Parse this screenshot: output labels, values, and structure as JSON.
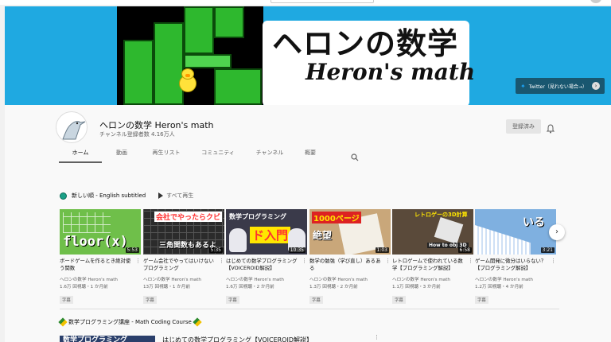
{
  "banner": {
    "title": "ヘロンの数学",
    "subtitle": "Heron's math",
    "twitter_link": "Twitter（見れない場合→）"
  },
  "channel": {
    "name": "ヘロンの数学 Heron's math",
    "subscribers": "チャンネル登録者数 4.16万人",
    "subscribe_button": "登録済み"
  },
  "tabs": [
    "ホーム",
    "動画",
    "再生リスト",
    "コミュニティ",
    "チャンネル",
    "概要"
  ],
  "shelf1": {
    "title": "新しい順 - English subtitled",
    "play_all": "すべて再生"
  },
  "videos": [
    {
      "title": "ボードゲームを作るとき絶対使う関数",
      "channel": "ヘロンの数学 Heron's math",
      "meta": "1.6万 回視聴・1 か月前",
      "badge": "字幕",
      "duration": "5:53",
      "thumb_text": "floor(x)",
      "thumb_bg": "#6fbf4a"
    },
    {
      "title": "ゲーム会社でやってはいけないプログラミング",
      "channel": "ヘロンの数学 Heron's math",
      "meta": "13万 回視聴・1 か月前",
      "badge": "字幕",
      "duration": "5:35",
      "thumb_text": "会社でやったらクビ",
      "thumb_text2": "三角関数もあるよ",
      "thumb_bg": "#2b2b2b"
    },
    {
      "title": "はじめての数学プログラミング【VOICEROID解説】",
      "channel": "ヘロンの数学 Heron's math",
      "meta": "1.6万 回視聴・2 か月前",
      "badge": "字幕",
      "duration": "10:35",
      "thumb_text": "数学プログラミング",
      "thumb_text2": "ド入門",
      "thumb_bg": "#3a3a4a"
    },
    {
      "title": "数学の勉強（学び直し）あるある",
      "channel": "ヘロンの数学 Heron's math",
      "meta": "1.3万 回視聴・2 か月前",
      "badge": "字幕",
      "duration": "1:03",
      "thumb_text": "1000ページ",
      "thumb_text2": "絶望",
      "thumb_bg": "#c9a77a"
    },
    {
      "title": "レトロゲームで使われている数学【プログラミング解説】",
      "channel": "ヘロンの数学 Heron's math",
      "meta": "1.1万 回視聴・3 か月前",
      "badge": "字幕",
      "duration": "6:58",
      "thumb_text": "レトロゲーの3D計算",
      "thumb_text2": "How to obj 3D",
      "thumb_bg": "#5a4a3a"
    },
    {
      "title": "ゲーム開発に微分はいらない？【プログラミング解説】",
      "channel": "ヘロンの数学 Heron's math",
      "meta": "1.2万 回視聴・4 か月前",
      "badge": "字幕",
      "duration": "3:21",
      "thumb_text": "いる",
      "thumb_bg": "#7fb0e0"
    }
  ],
  "shelf2": {
    "title": "数学プログラミング講座 - Math Coding Course",
    "first_video_title": "はじめての数学プログラミング【VOICEROID解説】",
    "first_thumb_text": "数学プログラミング"
  },
  "icons": {
    "bell": "bell-icon",
    "search": "search-icon",
    "next": "chevron-right-icon",
    "twitter": "twitter-icon"
  }
}
